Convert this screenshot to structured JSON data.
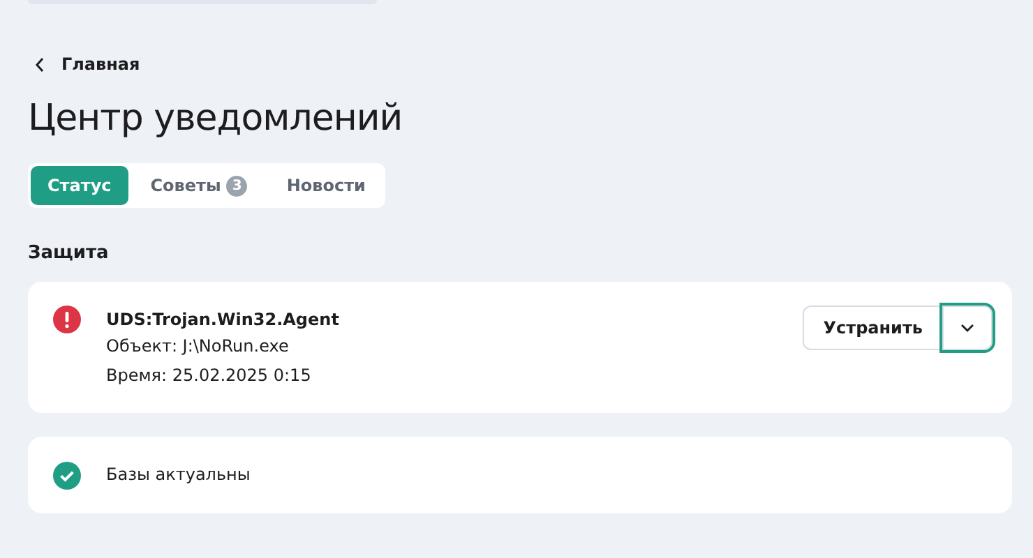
{
  "back_link": {
    "label": "Главная"
  },
  "title": "Центр уведомлений",
  "tabs": [
    {
      "label": "Статус",
      "selected": true
    },
    {
      "label": "Советы",
      "selected": false,
      "badge": "3"
    },
    {
      "label": "Новости",
      "selected": false
    }
  ],
  "section": {
    "title": "Защита"
  },
  "notifications": [
    {
      "kind": "threat",
      "title": "UDS:Trojan.Win32.Agent",
      "lines": [
        "Объект: J:\\NoRun.exe",
        "Время: 25.02.2025 0:15"
      ],
      "action": {
        "label": "Устранить",
        "menu_focused": true
      }
    },
    {
      "kind": "ok",
      "text": "Базы актуальны"
    }
  ]
}
